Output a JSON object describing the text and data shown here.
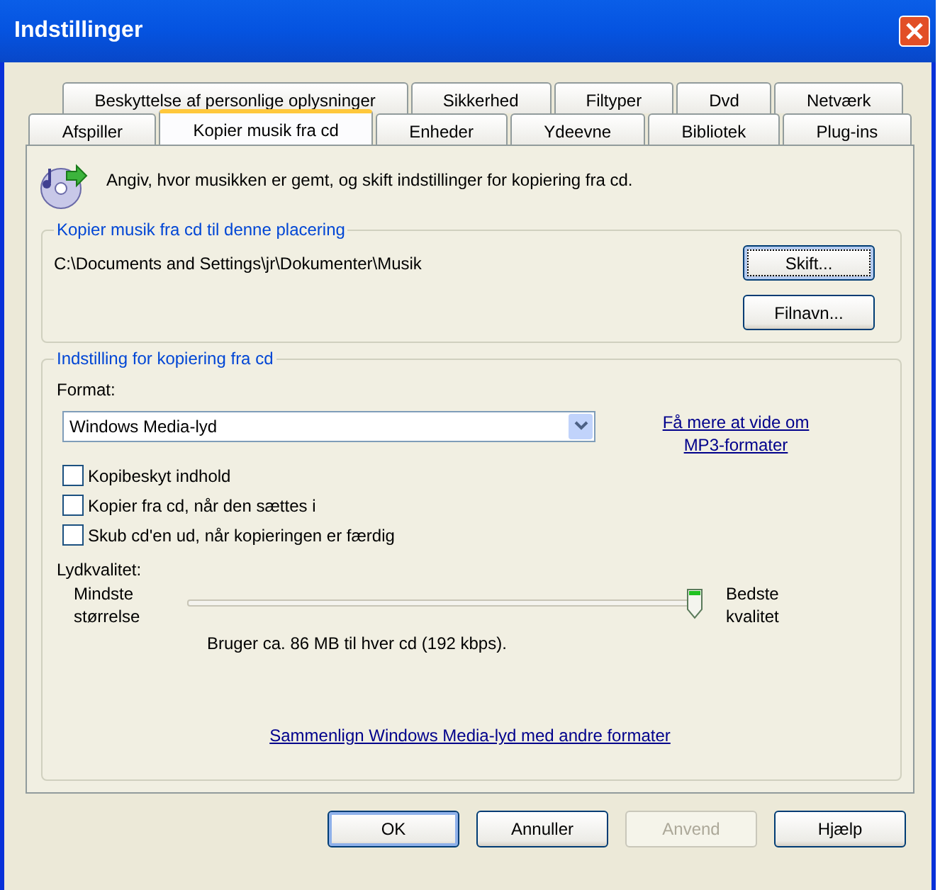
{
  "window": {
    "title": "Indstillinger"
  },
  "tab_rows": [
    [
      {
        "label": "Beskyttelse af personlige oplysninger",
        "selected": false
      },
      {
        "label": "Sikkerhed",
        "selected": false
      },
      {
        "label": "Filtyper",
        "selected": false
      },
      {
        "label": "Dvd",
        "selected": false
      },
      {
        "label": "Netværk",
        "selected": false
      }
    ],
    [
      {
        "label": "Afspiller",
        "selected": false
      },
      {
        "label": "Kopier musik fra cd",
        "selected": true
      },
      {
        "label": "Enheder",
        "selected": false
      },
      {
        "label": "Ydeevne",
        "selected": false
      },
      {
        "label": "Bibliotek",
        "selected": false
      },
      {
        "label": "Plug-ins",
        "selected": false
      }
    ]
  ],
  "intro": "Angiv, hvor musikken er gemt, og skift indstillinger for kopiering fra cd.",
  "location_group": {
    "title": "Kopier musik fra cd til denne placering",
    "path": "C:\\Documents and Settings\\jr\\Dokumenter\\Musik",
    "buttons": [
      {
        "label": "Skift...",
        "focused": true
      },
      {
        "label": "Filnavn...",
        "focused": false
      }
    ]
  },
  "settings_group": {
    "title": "Indstilling for kopiering fra cd",
    "format_label": "Format:",
    "format_value": "Windows Media-lyd",
    "format_link": "Få mere at vide om MP3-formater",
    "checkboxes": [
      {
        "label": "Kopibeskyt indhold",
        "checked": false
      },
      {
        "label": "Kopier fra cd, når den sættes i",
        "checked": false
      },
      {
        "label": "Skub cd'en ud, når kopieringen er færdig",
        "checked": false
      }
    ],
    "quality_label": "Lydkvalitet:",
    "quality_min": "Mindste størrelse",
    "quality_max": "Bedste kvalitet",
    "quality": {
      "level": 1
    },
    "usage": "Bruger ca. 86 MB til hver cd (192 kbps).",
    "compare_link": "Sammenlign Windows Media-lyd med andre formater"
  },
  "buttons": [
    {
      "label": "OK",
      "disabled": false,
      "default": true
    },
    {
      "label": "Annuller",
      "disabled": false,
      "default": false
    },
    {
      "label": "Anvend",
      "disabled": true,
      "default": false
    },
    {
      "label": "Hjælp",
      "disabled": false,
      "default": false
    }
  ]
}
